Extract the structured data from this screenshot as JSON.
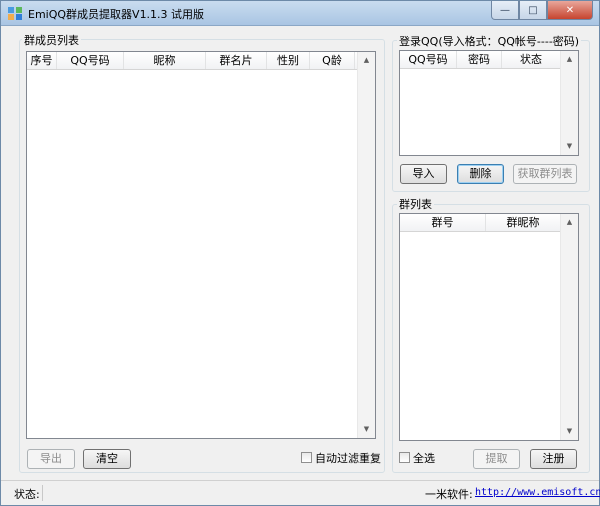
{
  "window": {
    "title": "EmiQQ群成员提取器V1.1.3 试用版",
    "controls": {
      "minimize": "—",
      "maximize": "□",
      "close": "✕"
    }
  },
  "members": {
    "group_label": "群成员列表",
    "columns": [
      "序号",
      "QQ号码",
      "昵称",
      "群名片",
      "性别",
      "Q龄"
    ],
    "rows": [],
    "export_button": "导出",
    "clear_button": "清空",
    "auto_filter_label": "自动过滤重复",
    "auto_filter_checked": false
  },
  "login": {
    "group_label": "登录QQ(导入格式：QQ帐号----密码)",
    "columns": [
      "QQ号码",
      "密码",
      "状态"
    ],
    "rows": [],
    "import_button": "导入",
    "delete_button": "删除",
    "fetch_groups_button": "获取群列表"
  },
  "groups": {
    "group_label": "群列表",
    "columns": [
      "群号",
      "群昵称"
    ],
    "rows": [],
    "select_all_label": "全选",
    "select_all_checked": false,
    "extract_button": "提取",
    "register_button": "注册"
  },
  "status": {
    "label": "状态:",
    "value": "",
    "vendor_label": "一米软件:",
    "vendor_url": "http://www.emisoft.cn"
  }
}
